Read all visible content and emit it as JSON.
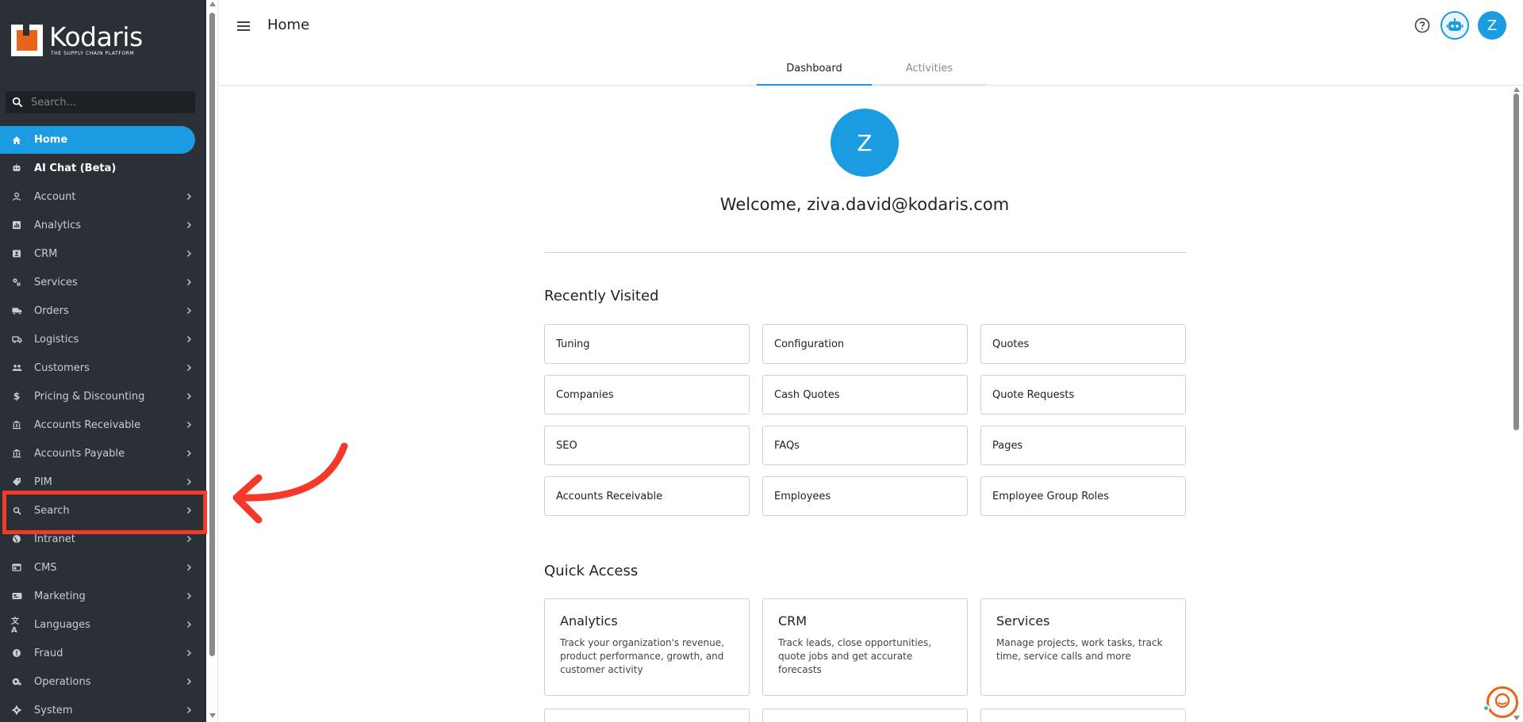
{
  "sidebar": {
    "brand": {
      "name": "Kodaris",
      "tagline": "THE SUPPLY CHAIN PLATFORM"
    },
    "search": {
      "placeholder": "Search..."
    },
    "items": [
      {
        "label": "Home",
        "icon": "home-icon"
      },
      {
        "label": "AI Chat (Beta)",
        "icon": "robot-icon"
      },
      {
        "label": "Account",
        "icon": "person-icon"
      },
      {
        "label": "Analytics",
        "icon": "analytics-icon"
      },
      {
        "label": "CRM",
        "icon": "contacts-icon"
      },
      {
        "label": "Services",
        "icon": "gears-icon"
      },
      {
        "label": "Orders",
        "icon": "truck-icon"
      },
      {
        "label": "Logistics",
        "icon": "logistics-icon"
      },
      {
        "label": "Customers",
        "icon": "people-icon"
      },
      {
        "label": "Pricing & Discounting",
        "icon": "dollar-icon"
      },
      {
        "label": "Accounts Receivable",
        "icon": "bank-icon"
      },
      {
        "label": "Accounts Payable",
        "icon": "bank-icon"
      },
      {
        "label": "PIM",
        "icon": "tag-icon"
      },
      {
        "label": "Search",
        "icon": "search-icon"
      },
      {
        "label": "Intranet",
        "icon": "globe-icon"
      },
      {
        "label": "CMS",
        "icon": "web-icon"
      },
      {
        "label": "Marketing",
        "icon": "megaphone-icon"
      },
      {
        "label": "Languages",
        "icon": "translate-icon"
      },
      {
        "label": "Fraud",
        "icon": "shield-icon"
      },
      {
        "label": "Operations",
        "icon": "operations-icon"
      },
      {
        "label": "System",
        "icon": "gear-icon"
      }
    ]
  },
  "header": {
    "title": "Home",
    "avatar_initial": "Z",
    "tabs": [
      {
        "label": "Dashboard"
      },
      {
        "label": "Activities"
      }
    ]
  },
  "main": {
    "avatar_initial": "Z",
    "welcome": "Welcome, ziva.david@kodaris.com",
    "recently_visited": {
      "title": "Recently Visited",
      "items": [
        "Tuning",
        "Configuration",
        "Quotes",
        "Companies",
        "Cash Quotes",
        "Quote Requests",
        "SEO",
        "FAQs",
        "Pages",
        "Accounts Receivable",
        "Employees",
        "Employee Group Roles"
      ]
    },
    "quick_access": {
      "title": "Quick Access",
      "items": [
        {
          "title": "Analytics",
          "desc": "Track your organization's revenue, product performance, growth, and customer activity"
        },
        {
          "title": "CRM",
          "desc": "Track leads, close opportunities, quote jobs and get accurate forecasts"
        },
        {
          "title": "Services",
          "desc": "Manage projects, work tasks, track time, service calls and more"
        }
      ]
    }
  },
  "colors": {
    "sidebar_bg": "#2b2f36",
    "accent": "#1a9be2",
    "brand_orange": "#e8641b",
    "annotation_red": "#f4392b"
  }
}
